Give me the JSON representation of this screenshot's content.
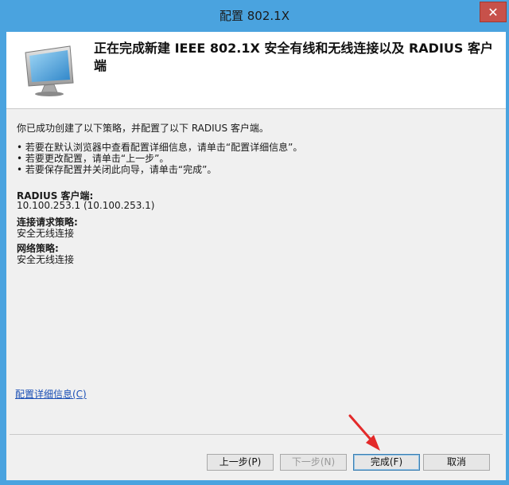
{
  "window": {
    "title": "配置 802.1X",
    "close_glyph": "✕"
  },
  "header": {
    "title": "正在完成新建 IEEE 802.1X 安全有线和无线连接以及 RADIUS 客户端"
  },
  "content": {
    "intro": "你已成功创建了以下策略，并配置了以下 RADIUS 客户端。",
    "bullets": [
      "• 若要在默认浏览器中查看配置详细信息，请单击“配置详细信息”。",
      "• 若要更改配置，请单击“上一步”。",
      "• 若要保存配置并关闭此向导，请单击“完成”。"
    ],
    "radius_label": "RADIUS 客户端:",
    "radius_value": "10.100.253.1 (10.100.253.1)",
    "conn_policy_label": "连接请求策略:",
    "conn_policy_value": "安全无线连接",
    "net_policy_label": "网络策略:",
    "net_policy_value": "安全无线连接"
  },
  "link": {
    "details": "配置详细信息(C)"
  },
  "buttons": {
    "back": "上一步(P)",
    "next": "下一步(N)",
    "finish": "完成(F)",
    "cancel": "取消"
  },
  "colors": {
    "titlebar": "#4aa3df",
    "close": "#c7514a",
    "link": "#1a4fb5",
    "arrow": "#e32a2a"
  }
}
